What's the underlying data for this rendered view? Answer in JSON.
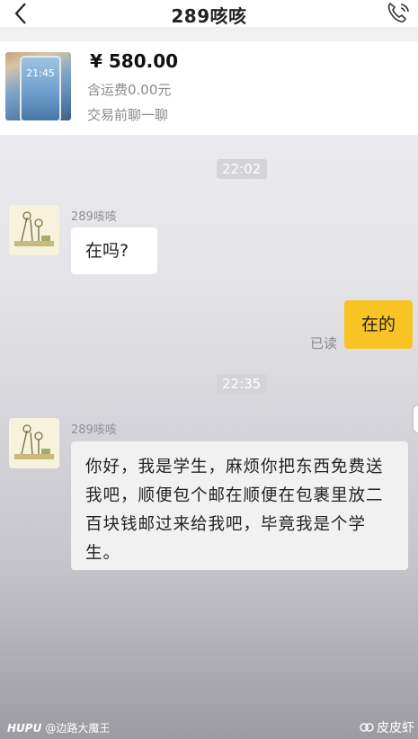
{
  "header": {
    "title": "289咳咳",
    "back_icon": "chevron-left-icon",
    "call_icon": "phone-icon"
  },
  "product": {
    "thumb_time": "21:45",
    "price": "¥ 580.00",
    "shipping": "含运费0.00元",
    "chat_note": "交易前聊一聊"
  },
  "messages": {
    "timestamp_1": "22:02",
    "sender_1": "289咳咳",
    "msg_1": "在吗?",
    "reply_1": "在的",
    "read_status": "已读",
    "timestamp_2": "22:35",
    "sender_2": "289咳咳",
    "msg_2": "你好，我是学生，麻烦你把东西免费送我吧，顺便包个邮在顺便在包裹里放二百块钱邮过来给我吧，毕竟我是个学生。"
  },
  "watermark": {
    "left_brand": "HUPU",
    "left_user": "@边路大魔王",
    "right": "皮皮虾"
  },
  "colors": {
    "outgoing_bubble": "#f7c325",
    "incoming_bubble": "#ffffff",
    "timestamp_bg": "#d3d3d8"
  }
}
